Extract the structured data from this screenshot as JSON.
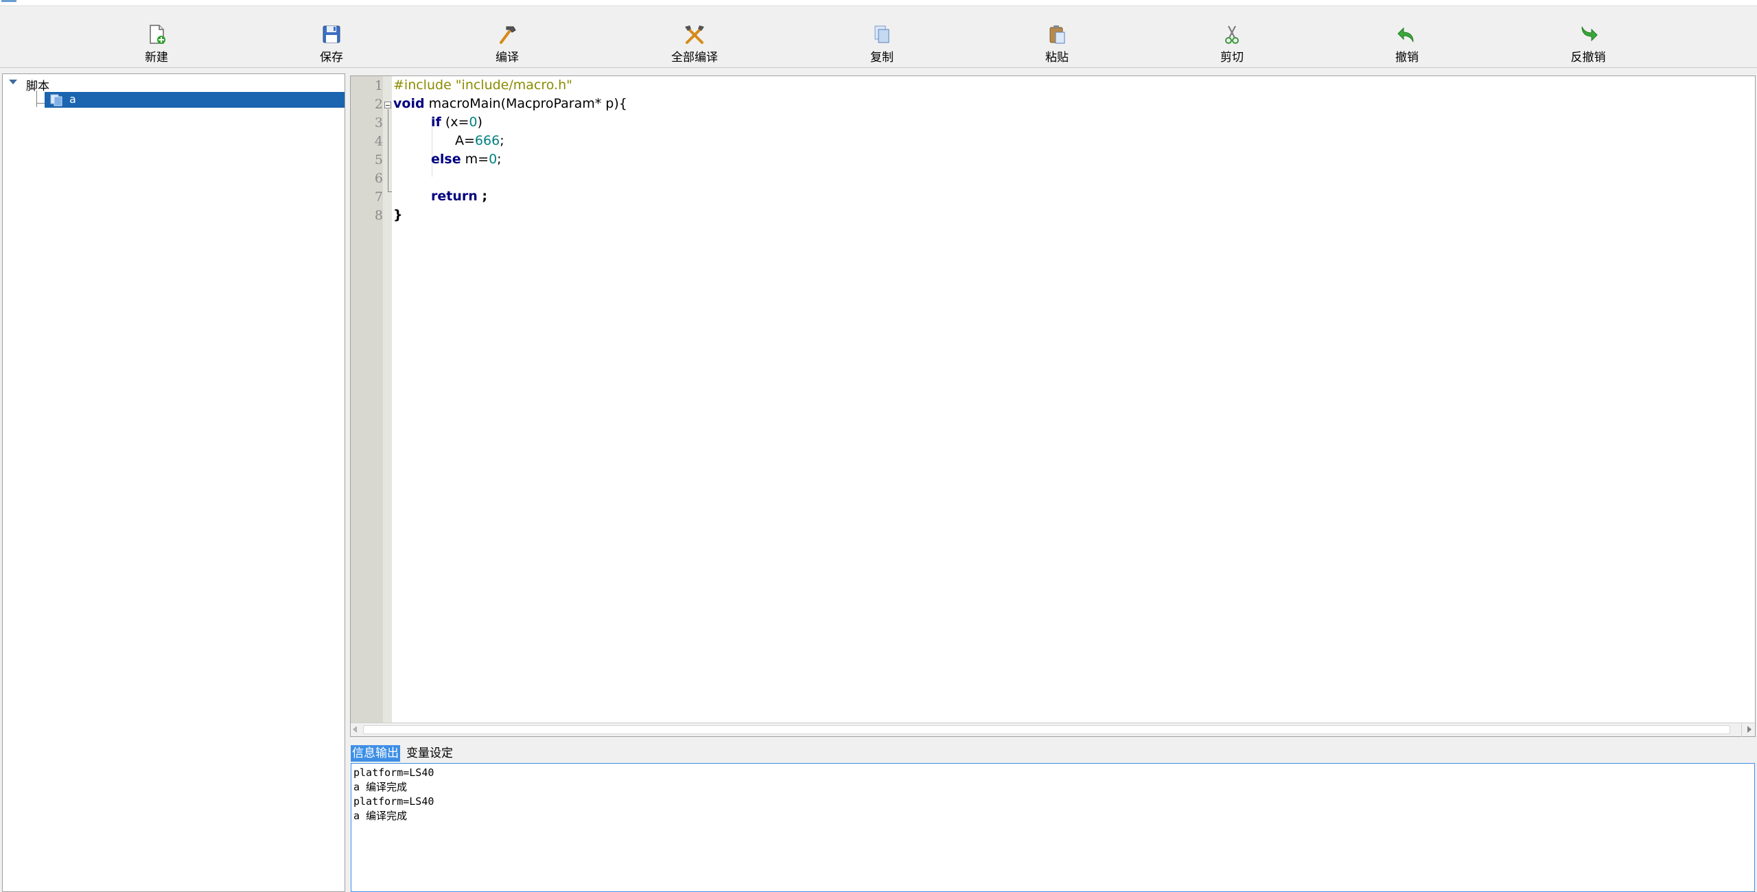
{
  "toolbar": {
    "buttons": [
      {
        "id": "new",
        "label": "新建",
        "icon": "new-file-icon"
      },
      {
        "id": "save",
        "label": "保存",
        "icon": "floppy-disk-icon"
      },
      {
        "id": "compile",
        "label": "编译",
        "icon": "hammer-icon"
      },
      {
        "id": "compile_all",
        "label": "全部编译",
        "icon": "crossed-tools-icon"
      },
      {
        "id": "copy",
        "label": "复制",
        "icon": "copy-icon"
      },
      {
        "id": "paste",
        "label": "粘贴",
        "icon": "clipboard-icon"
      },
      {
        "id": "cut",
        "label": "剪切",
        "icon": "scissors-icon"
      },
      {
        "id": "undo",
        "label": "撤销",
        "icon": "undo-arrow-icon"
      },
      {
        "id": "redo",
        "label": "反撤销",
        "icon": "redo-arrow-icon"
      }
    ]
  },
  "tree": {
    "root_label": "脚本",
    "children": [
      {
        "label": "a",
        "icon": "script-file-icon",
        "selected": true
      }
    ]
  },
  "editor": {
    "line_numbers": [
      "1",
      "2",
      "3",
      "4",
      "5",
      "6",
      "7",
      "8"
    ],
    "lines": {
      "l1": "#include \"include/macro.h\"",
      "l2_kw": "void",
      "l2_rest": " macroMain(MacproParam* p){",
      "l3_kw": "if",
      "l3_a": " (x=",
      "l3_num": "0",
      "l3_b": ")",
      "l4_a": "A=",
      "l4_num": "666",
      "l4_b": ";",
      "l5_kw": "else",
      "l5_a": " m=",
      "l5_num": "0",
      "l5_b": ";",
      "l7_kw": "return",
      "l7_b": " ;",
      "l8": "}"
    }
  },
  "tabs": [
    {
      "label": "信息输出",
      "active": true
    },
    {
      "label": "变量设定",
      "active": false
    }
  ],
  "output": {
    "lines": [
      "platform=LS40",
      "a 编译完成",
      "platform=LS40",
      "a 编译完成"
    ]
  },
  "colors": {
    "selection": "#1a64b0",
    "active_tab": "#3d8fe6",
    "preprocessor": "#8b8b00",
    "keyword": "#000080",
    "number": "#008080"
  }
}
